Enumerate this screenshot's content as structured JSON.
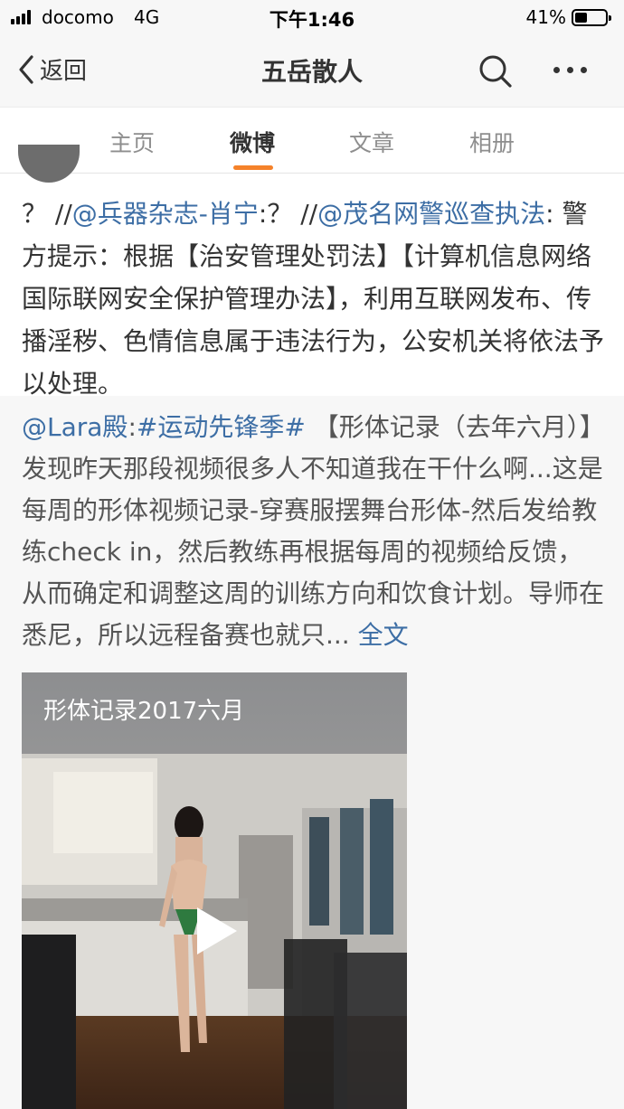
{
  "status_bar": {
    "carrier": "docomo",
    "network": "4G",
    "time": "下午1:46",
    "battery_percent": "41%",
    "battery_level": 0.41
  },
  "nav": {
    "back_label": "返回",
    "title": "五岳散人",
    "icons": [
      "chevron-left-icon",
      "search-icon",
      "more-icon"
    ]
  },
  "tabs": [
    {
      "label": "主页",
      "active": false
    },
    {
      "label": "微博",
      "active": true
    },
    {
      "label": "文章",
      "active": false
    },
    {
      "label": "相册",
      "active": false
    }
  ],
  "colors": {
    "accent_orange": "#f5822a",
    "link_blue": "#3d6ea5",
    "quoted_background": "#f7f7f7"
  },
  "post": {
    "prefix_1": "？ //",
    "mention_1": "@兵器杂志-肖宁",
    "middle": ":？ //",
    "mention_2": "@茂名网警巡查执法",
    "body": ": 警方提示：根据【治安管理处罚法】【计算机信息网络国际联网安全保护管理办法】，利用互联网发布、传播淫秽、色情信息属于违法行为，公安机关将依法予以处理。"
  },
  "quoted": {
    "author": "@Lara殿",
    "colon": ":",
    "hashtag": "#运动先锋季#",
    "body": " 【形体记录（去年六月）】 发现昨天那段视频很多人不知道我在干什么啊...这是每周的形体视频记录-穿赛服摆舞台形体-然后发给教练check in，然后教练再根据每周的视频给反馈，从而确定和调整这周的训练方向和饮食计划。导师在悉尼，所以远程备赛也就只... ",
    "more_label": "全文"
  },
  "video": {
    "title": "形体记录2017六月",
    "icon": "play-icon"
  }
}
